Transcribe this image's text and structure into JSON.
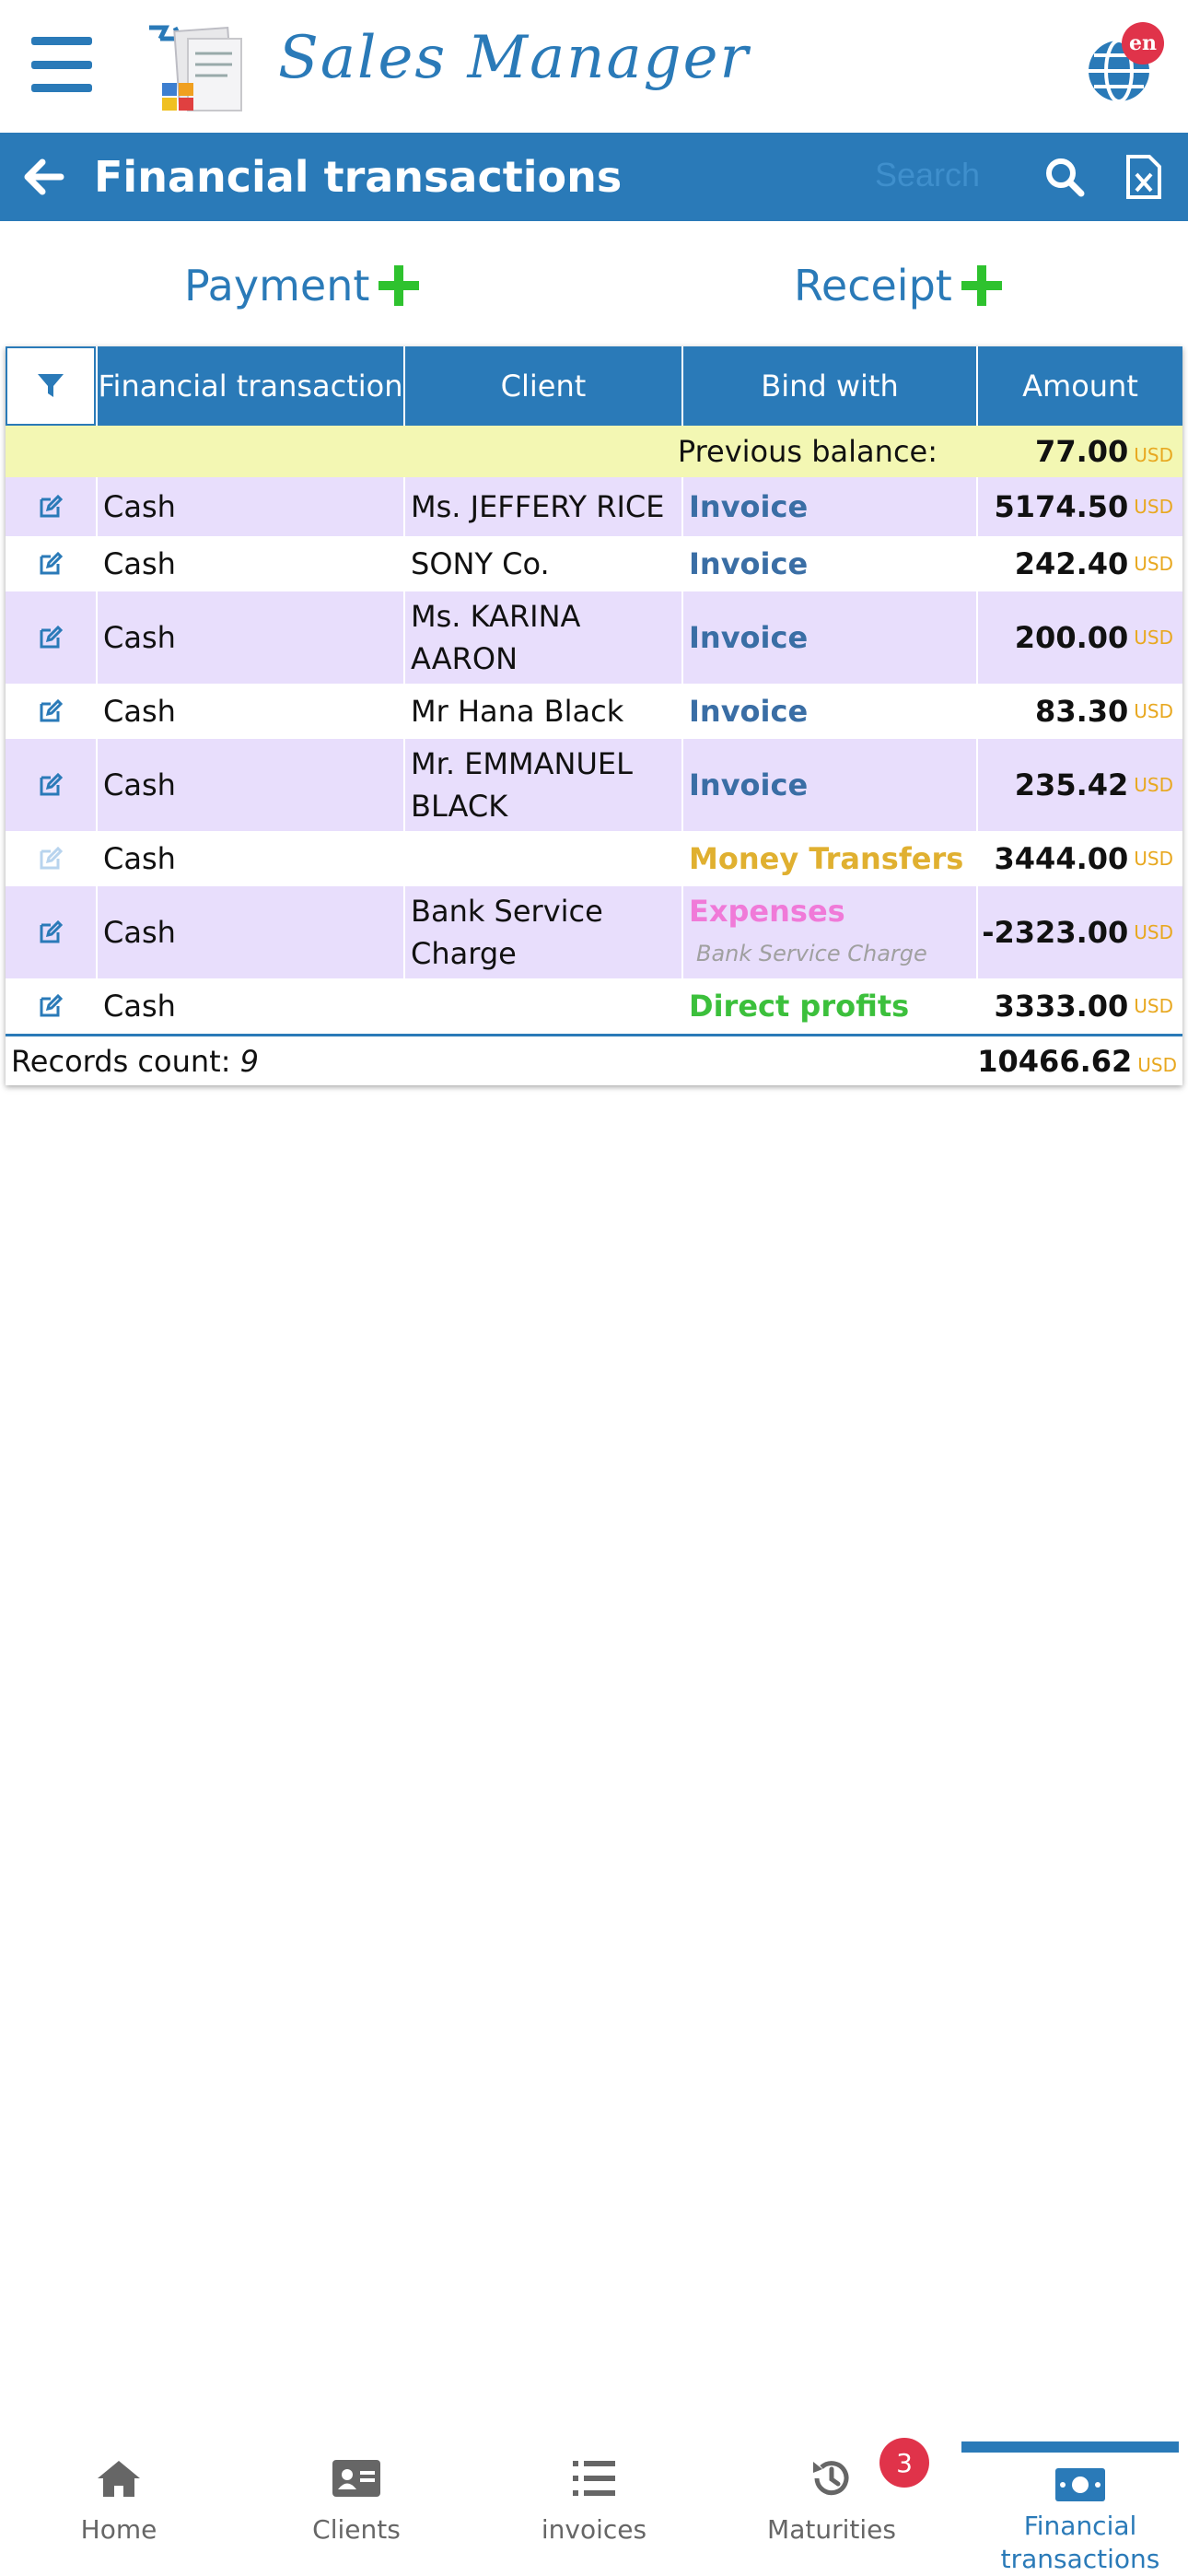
{
  "header": {
    "app_name": "Sales Manager",
    "lang_badge": "en"
  },
  "title_bar": {
    "title": "Financial transactions",
    "search_placeholder": "Search"
  },
  "actions": {
    "payment_label": "Payment",
    "receipt_label": "Receipt"
  },
  "table": {
    "columns": [
      "Financial transaction",
      "Client",
      "Bind with",
      "Amount"
    ],
    "previous_balance_label": "Previous balance:",
    "previous_balance_amount": "77.00",
    "currency": "USD",
    "rows": [
      {
        "transaction": "Cash",
        "client": "Ms. JEFFERY RICE",
        "bind": "Invoice",
        "bind_note": "",
        "amount": "5174.50",
        "bind_color": "#3a6ea5"
      },
      {
        "transaction": "Cash",
        "client": "SONY Co.",
        "bind": "Invoice",
        "bind_note": "",
        "amount": "242.40",
        "bind_color": "#3a6ea5"
      },
      {
        "transaction": "Cash",
        "client": "Ms. KARINA AARON",
        "bind": "Invoice",
        "bind_note": "",
        "amount": "200.00",
        "bind_color": "#3a6ea5"
      },
      {
        "transaction": "Cash",
        "client": "Mr Hana Black",
        "bind": "Invoice",
        "bind_note": "",
        "amount": "83.30",
        "bind_color": "#3a6ea5"
      },
      {
        "transaction": "Cash",
        "client": "Mr. EMMANUEL BLACK",
        "bind": "Invoice",
        "bind_note": "",
        "amount": "235.42",
        "bind_color": "#3a6ea5"
      },
      {
        "transaction": "Cash",
        "client": "",
        "bind": "Money Transfers",
        "bind_note": "",
        "amount": "3444.00",
        "bind_color": "#e0b030"
      },
      {
        "transaction": "Cash",
        "client": "Bank Service Charge",
        "bind": "Expenses",
        "bind_note": "Bank Service Charge",
        "amount": "-2323.00",
        "bind_color": "#f07ad8"
      },
      {
        "transaction": "Cash",
        "client": "",
        "bind": "Direct profits",
        "bind_note": "",
        "amount": "3333.00",
        "bind_color": "#3cc03c"
      }
    ],
    "records_count_label": "Records count:",
    "records_count": "9",
    "total_amount": "10466.62"
  },
  "bottom_nav": {
    "items": [
      {
        "label": "Home",
        "icon": "home-icon"
      },
      {
        "label": "Clients",
        "icon": "id-card-icon"
      },
      {
        "label": "invoices",
        "icon": "list-icon"
      },
      {
        "label": "Maturities",
        "icon": "history-icon"
      },
      {
        "label": "Financial transactions",
        "icon": "money-bill-icon"
      }
    ],
    "maturities_badge": "3",
    "active_index": 4
  },
  "colors": {
    "primary": "#2a7ab8",
    "plus_green": "#2ec22e",
    "row_alt": "#e8defc",
    "prev_balance_bg": "#f3f7b3",
    "currency": "#e8a820",
    "badge_red": "#e0334a"
  }
}
